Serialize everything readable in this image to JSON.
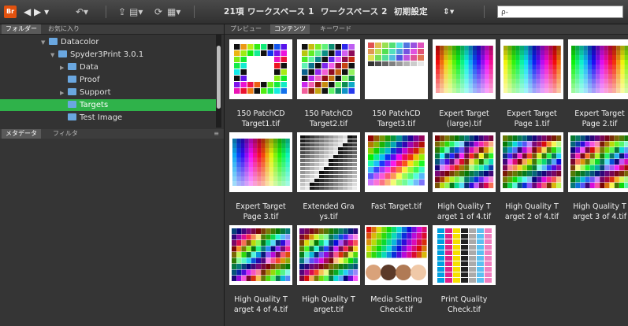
{
  "toolbar": {
    "app_icon_label": "Br",
    "items_count": "21項",
    "workspace_1": "ワークスペース 1",
    "workspace_2": "ワークスペース 2",
    "initial_settings": "初期設定",
    "search_placeholder": "ρ-"
  },
  "left_panel": {
    "tabs": [
      "フォルダー",
      "お気に入り"
    ],
    "tree": [
      {
        "label": "Datacolor",
        "level": 1,
        "expanded": true
      },
      {
        "label": "Spyder3Print 3.0.1",
        "level": 2,
        "expanded": true
      },
      {
        "label": "Data",
        "level": 3,
        "expanded": false
      },
      {
        "label": "Proof",
        "level": 3,
        "expanded": false
      },
      {
        "label": "Support",
        "level": 3,
        "expanded": false
      },
      {
        "label": "Targets",
        "level": 3,
        "selected": true
      },
      {
        "label": "Test Image",
        "level": 3
      }
    ],
    "lower_tabs": [
      "メタデータ",
      "フィルタ"
    ]
  },
  "content": {
    "tabs": [
      "プレビュー",
      "コンテンツ",
      "キーワード"
    ],
    "items": [
      {
        "line1": "150 PatchCD",
        "line2": "Target1.tif",
        "style": "ring"
      },
      {
        "line1": "150 PatchCD",
        "line2": "Target2.tif",
        "style": "ring2"
      },
      {
        "line1": "150 PatchCD",
        "line2": "Target3.tif",
        "style": "sparse"
      },
      {
        "line1": "Expert Target",
        "line2": "(large).tif",
        "style": "gradient"
      },
      {
        "line1": "Expert Target",
        "line2": "Page 1.tif",
        "style": "gradient2"
      },
      {
        "line1": "Expert Target",
        "line2": "Page 2.tif",
        "style": "gradient3"
      },
      {
        "line1": "Expert Target",
        "line2": "Page 3.tif",
        "style": "gradient4"
      },
      {
        "line1": "Extended Gra",
        "line2": "ys.tif",
        "style": "grays"
      },
      {
        "line1": "Fast Target.tif",
        "line2": "",
        "style": "fast"
      },
      {
        "line1": "High Quality T",
        "line2": "arget 1 of 4.tif",
        "style": "hq1"
      },
      {
        "line1": "High Quality T",
        "line2": "arget 2 of 4.tif",
        "style": "hq2"
      },
      {
        "line1": "High Quality T",
        "line2": "arget 3 of 4.tif",
        "style": "hq3"
      },
      {
        "line1": "High Quality T",
        "line2": "arget 4 of 4.tif",
        "style": "hq4"
      },
      {
        "line1": "High Quality T",
        "line2": "arget.tif",
        "style": "hq5"
      },
      {
        "line1": "Media Setting",
        "line2": "Check.tif",
        "style": "faces"
      },
      {
        "line1": "Print Quality",
        "line2": "Check.tif",
        "style": "print"
      }
    ]
  },
  "colors": {
    "selection": "#2fb24a",
    "folder": "#6aa7e0",
    "app_icon": "#e2520f"
  }
}
